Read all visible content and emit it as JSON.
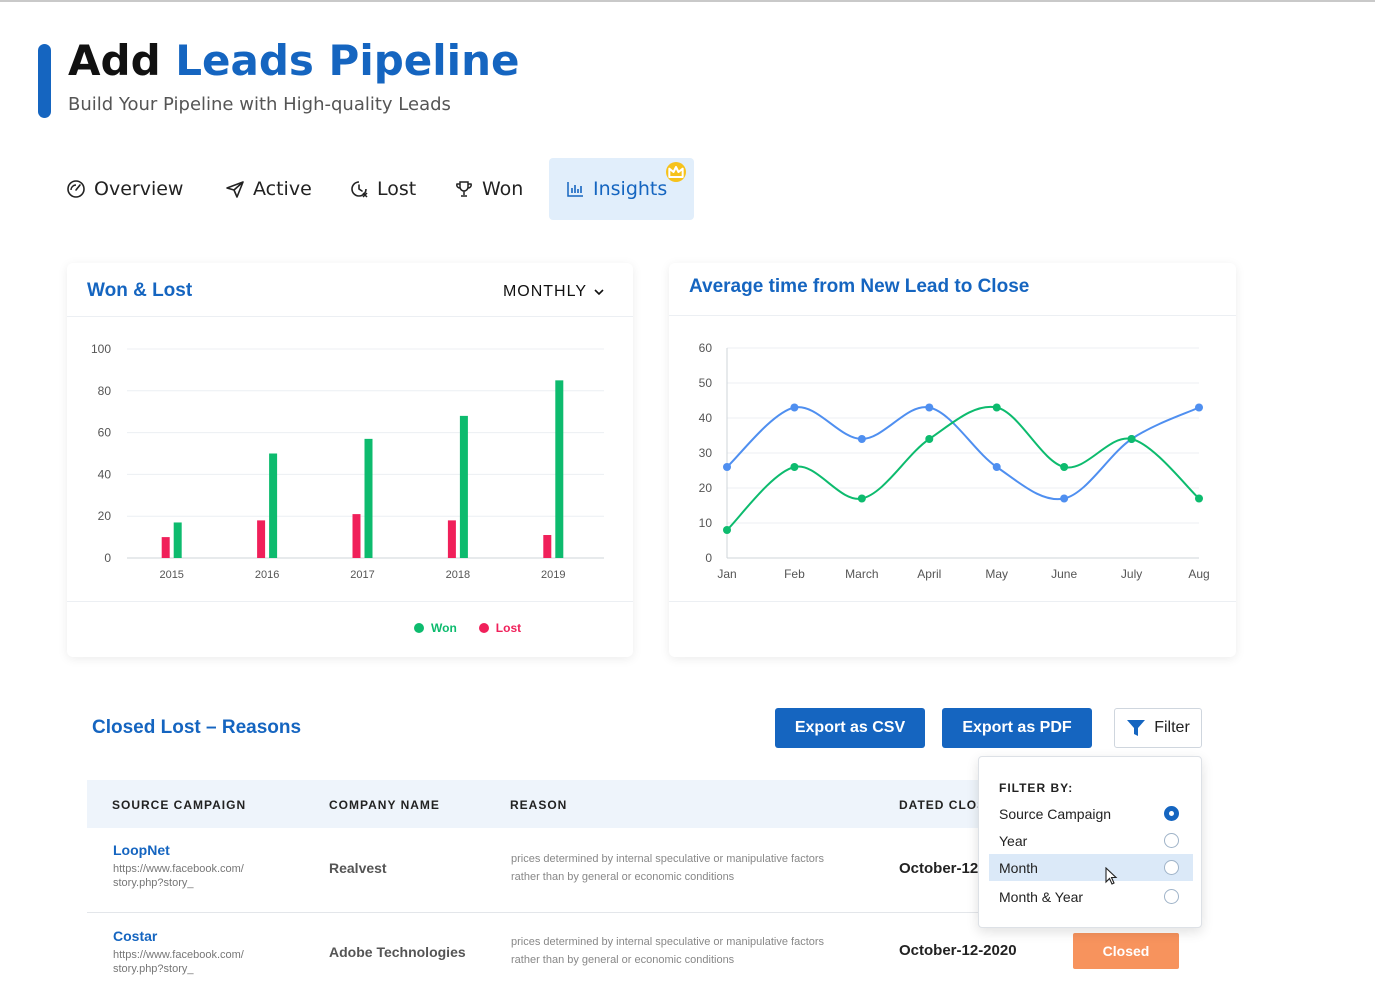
{
  "header": {
    "title_plain": "Add",
    "title_highlight": "Leads Pipeline",
    "subtitle": "Build Your Pipeline with High-quality Leads"
  },
  "tabs": [
    {
      "label": "Overview",
      "icon": "gauge-icon"
    },
    {
      "label": "Active",
      "icon": "paper-plane-icon"
    },
    {
      "label": "Lost",
      "icon": "clock-x-icon"
    },
    {
      "label": "Won",
      "icon": "trophy-icon"
    },
    {
      "label": "Insights",
      "icon": "bar-chart-icon",
      "active": true,
      "badge": "crown-icon"
    }
  ],
  "won_lost_card": {
    "title": "Won & Lost",
    "period_label": "MONTHLY",
    "legend": [
      {
        "label": "Won",
        "color": "#0dbb6e"
      },
      {
        "label": "Lost",
        "color": "#f0205a"
      }
    ]
  },
  "avg_time_card": {
    "title": "Average time from New Lead to Close"
  },
  "chart_data": [
    {
      "type": "bar",
      "categories": [
        "2015",
        "2016",
        "2017",
        "2018",
        "2019"
      ],
      "series": [
        {
          "name": "Won",
          "values": [
            17,
            50,
            57,
            68,
            85
          ],
          "color": "#0dbb6e"
        },
        {
          "name": "Lost",
          "values": [
            10,
            18,
            21,
            18,
            11
          ],
          "color": "#f0205a"
        }
      ],
      "ylim": [
        0,
        100
      ],
      "yticks": [
        0,
        20,
        40,
        60,
        80,
        100
      ],
      "grid": true,
      "legend_position": "bottom"
    },
    {
      "type": "line",
      "categories": [
        "Jan",
        "Feb",
        "March",
        "April",
        "May",
        "June",
        "July",
        "Aug"
      ],
      "series": [
        {
          "values": [
            26,
            43,
            34,
            43,
            26,
            17,
            34,
            43
          ],
          "color": "#4f8ff0"
        },
        {
          "values": [
            8,
            26,
            17,
            34,
            43,
            26,
            34,
            17
          ],
          "color": "#0dbb6e"
        }
      ],
      "ylim": [
        0,
        60
      ],
      "yticks": [
        0,
        10,
        20,
        30,
        40,
        50,
        60
      ],
      "grid": true
    }
  ],
  "closed_lost": {
    "title": "Closed Lost – Reasons",
    "export_csv": "Export as CSV",
    "export_pdf": "Export as PDF",
    "filter_label": "Filter",
    "columns": [
      "SOURCE CAMPAIGN",
      "COMPANY NAME",
      "REASON",
      "DATED CLOS"
    ],
    "rows": [
      {
        "campaign": "LoopNet",
        "url_line1": "https://www.facebook.com/",
        "url_line2": "story.php?story_",
        "company": "Realvest",
        "reason_line1": "prices determined by internal speculative or manipulative factors",
        "reason_line2": "rather than by general or economic conditions",
        "date": "October-12"
      },
      {
        "campaign": "Costar",
        "url_line1": "https://www.facebook.com/",
        "url_line2": "story.php?story_",
        "company": "Adobe Technologies",
        "reason_line1": "prices determined by internal speculative or manipulative factors",
        "reason_line2": "rather than by general or economic conditions",
        "date": "October-12-2020",
        "status": "Closed"
      }
    ]
  },
  "filter_dropdown": {
    "heading": "FILTER BY:",
    "options": [
      {
        "label": "Source Campaign",
        "selected": true
      },
      {
        "label": "Year",
        "selected": false
      },
      {
        "label": "Month",
        "selected": false
      },
      {
        "label": "Month & Year",
        "selected": false
      }
    ]
  }
}
